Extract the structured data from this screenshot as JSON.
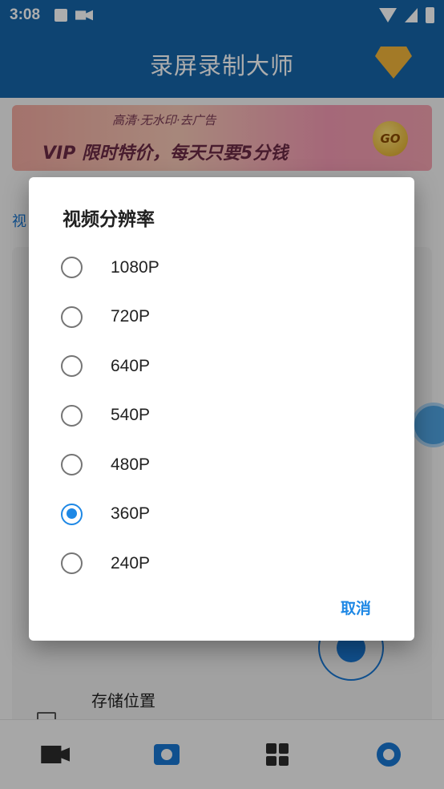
{
  "status_bar": {
    "time": "3:08"
  },
  "app_bar": {
    "title": "录屏录制大师"
  },
  "banner": {
    "subtitle": "高清·无水印·去广告",
    "headline": "VIP 限时特价，每天只要5分钱",
    "go_label": "GO"
  },
  "side_label": "视",
  "settings": {
    "storage_label": "存储位置"
  },
  "dialog": {
    "title": "视频分辨率",
    "options": [
      "1080P",
      "720P",
      "640P",
      "540P",
      "480P",
      "360P",
      "240P"
    ],
    "selected": "360P",
    "cancel_label": "取消"
  },
  "colors": {
    "primary": "#1565a8",
    "accent": "#1e88e5"
  }
}
